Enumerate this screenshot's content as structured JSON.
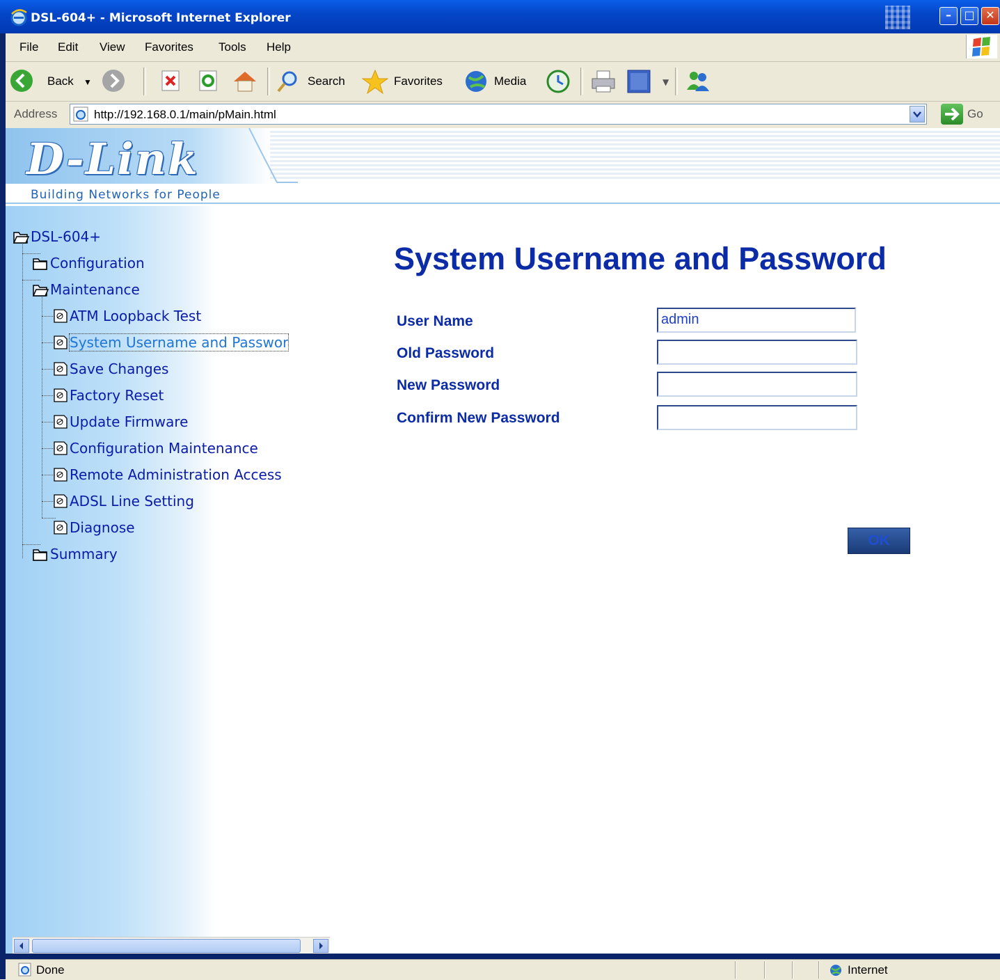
{
  "window": {
    "title": "DSL-604+ - Microsoft Internet Explorer"
  },
  "menubar": {
    "items": [
      "File",
      "Edit",
      "View",
      "Favorites",
      "Tools",
      "Help"
    ]
  },
  "toolbar": {
    "back_label": "Back",
    "search_label": "Search",
    "favorites_label": "Favorites",
    "media_label": "Media"
  },
  "address_bar": {
    "label": "Address",
    "url": "http://192.168.0.1/main/pMain.html",
    "go_label": "Go"
  },
  "banner": {
    "logo_text": "D-Link",
    "tagline": "Building Networks for People"
  },
  "tree": {
    "root": "DSL-604+",
    "configuration": "Configuration",
    "maintenance": "Maintenance",
    "maintenance_items": [
      "ATM Loopback Test",
      "System Username and Passwor",
      "Save Changes",
      "Factory Reset",
      "Update Firmware",
      "Configuration Maintenance",
      "Remote Administration Access",
      "ADSL Line Setting",
      "Diagnose"
    ],
    "summary": "Summary",
    "selected": "System Username and Passwor"
  },
  "form": {
    "heading": "System Username and Password",
    "user_name_label": "User Name",
    "user_name_value": "admin",
    "old_password_label": "Old Password",
    "new_password_label": "New Password",
    "confirm_password_label": "Confirm New Password",
    "ok_label": "OK"
  },
  "statusbar": {
    "status": "Done",
    "zone": "Internet"
  },
  "colors": {
    "accent": "#0c2ba6",
    "titlebar": "#0446c8"
  }
}
